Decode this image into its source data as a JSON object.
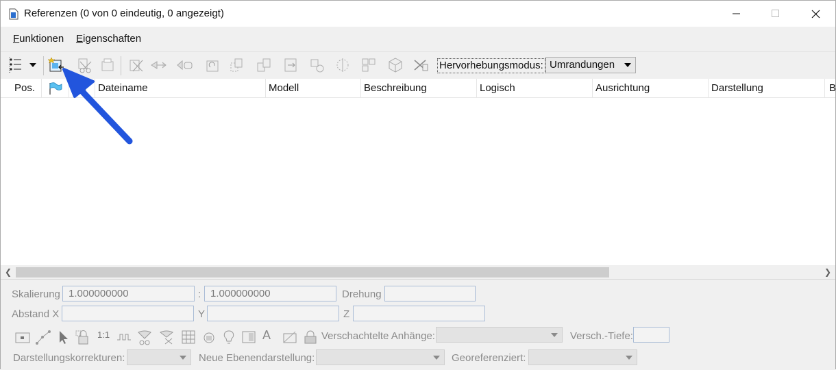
{
  "window": {
    "title": "Referenzen (0 von 0 eindeutig, 0 angezeigt)"
  },
  "menu": {
    "items": [
      {
        "label": "Funktionen"
      },
      {
        "label": "Eigenschaften"
      }
    ]
  },
  "toolbar": {
    "highlight_label": "Hervorhebungsmodus:",
    "highlight_value": "Umrandungen"
  },
  "table": {
    "columns": [
      "Pos.",
      "",
      "",
      "Dateiname",
      "Modell",
      "Beschreibung",
      "Logisch",
      "Ausrichtung",
      "Darstellung",
      "B"
    ]
  },
  "settings": {
    "scale_label": "Skalierung",
    "scale_value_1": "1.000000000",
    "scale_sep": ":",
    "scale_value_2": "1.000000000",
    "rotation_label": "Drehung",
    "offset_x_label": "Abstand X",
    "offset_y_label": "Y",
    "offset_z_label": "Z",
    "scale_1to1_label": "1:1",
    "text_icon_label": "A",
    "nested_label": "Verschachtelte Anhänge:",
    "depth_label": "Versch.-Tiefe:",
    "display_overrides_label": "Darstellungskorrekturen:",
    "new_level_label": "Neue Ebenendarstellung:",
    "georef_label": "Georeferenziert:"
  },
  "colors": {
    "annotation_arrow": "#2255dd",
    "title_icon": "#2b6fcf"
  }
}
